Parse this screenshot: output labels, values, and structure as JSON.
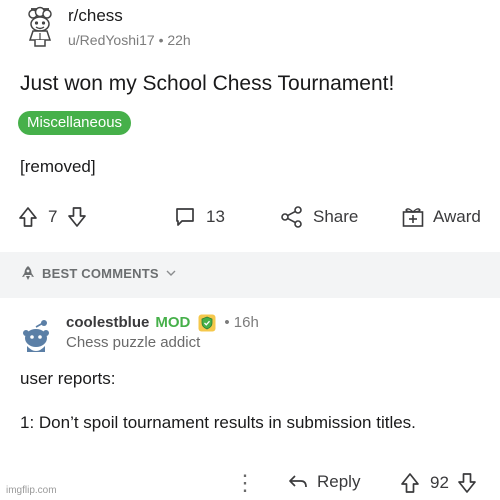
{
  "post": {
    "subreddit": "r/chess",
    "author": "u/RedYoshi17",
    "time": "22h",
    "separator": "•",
    "title": "Just won my School Chess Tournament!",
    "flair": "Miscellaneous",
    "body": "[removed]",
    "votes": "7",
    "comments": "13",
    "share_label": "Share",
    "award_label": "Award",
    "flair_color": "#46b04a"
  },
  "best_bar": {
    "label": "BEST COMMENTS"
  },
  "comment": {
    "author": "coolestblue",
    "mod_label": "MOD",
    "time": "16h",
    "separator": "•",
    "user_flair": "Chess puzzle addict",
    "line1": "user reports:",
    "line2": "1: Don’t spoil tournament results in submission titles.",
    "reply_label": "Reply",
    "votes": "92",
    "more_glyph": "⋮"
  },
  "watermark": "imgflip.com"
}
